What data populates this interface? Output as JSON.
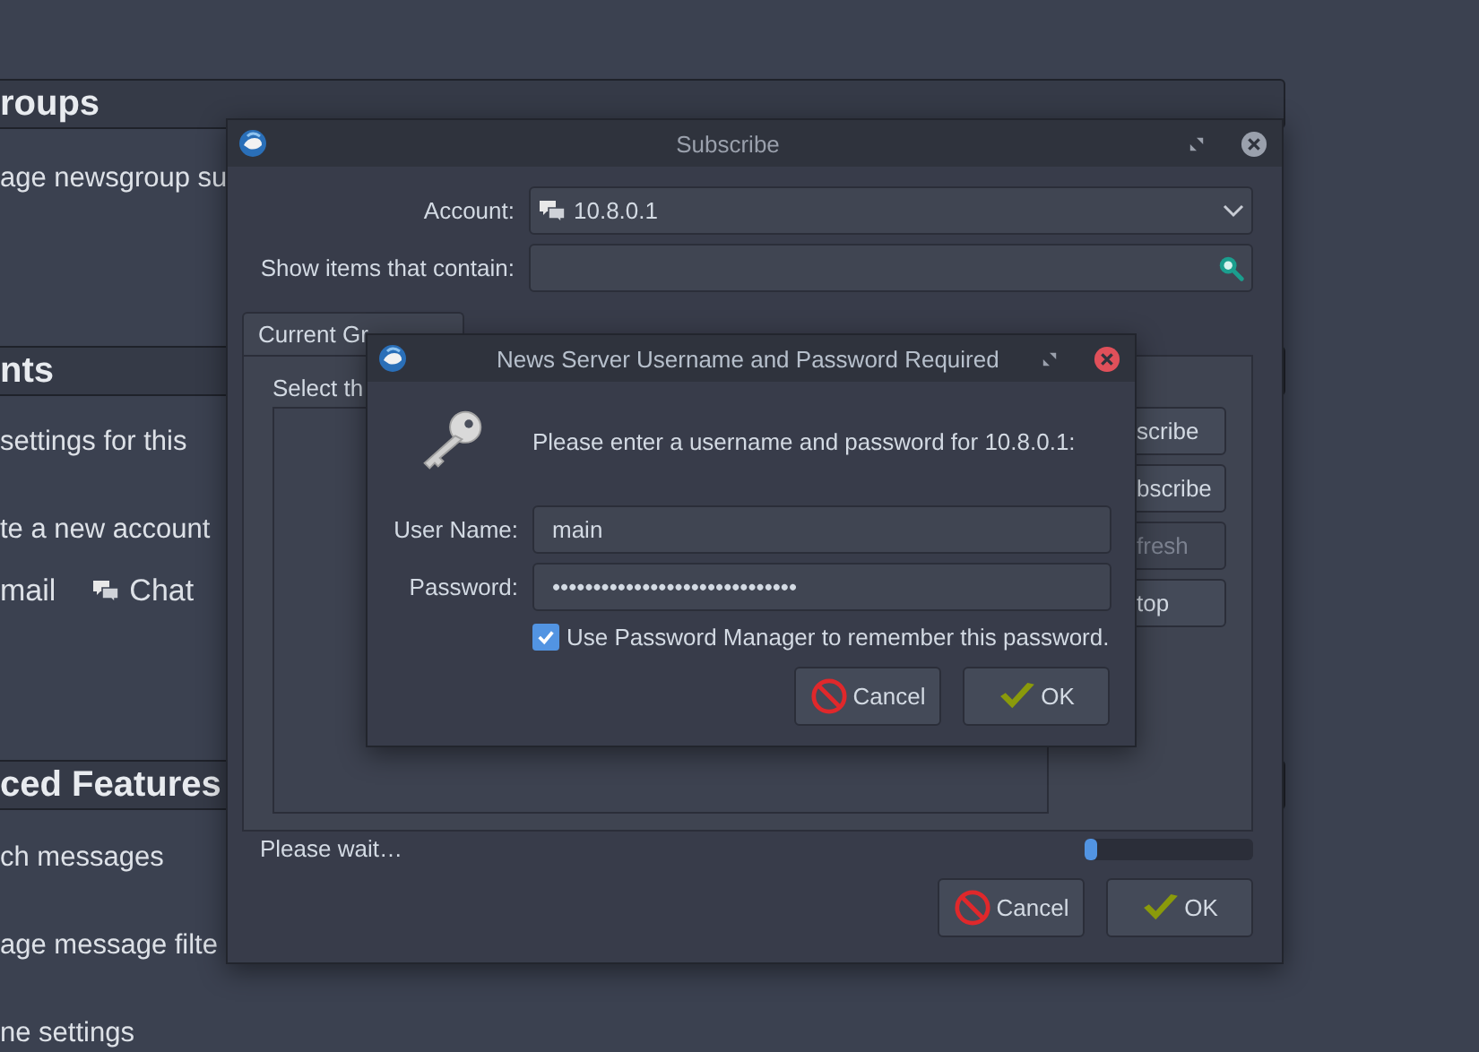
{
  "background_page": {
    "sections": [
      {
        "heading": "roups",
        "items": [
          {
            "kind": "text",
            "text": "age newsgroup su"
          }
        ]
      },
      {
        "heading": "nts",
        "items": [
          {
            "kind": "text",
            "text": "settings for this"
          },
          {
            "kind": "text",
            "text": "te a new account"
          },
          {
            "kind": "links",
            "links": [
              {
                "label": "mail",
                "kind": "plain"
              },
              {
                "label": "Chat",
                "kind": "chat"
              }
            ]
          }
        ]
      },
      {
        "heading": "ced Features",
        "items": [
          {
            "kind": "text",
            "text": "ch messages"
          },
          {
            "kind": "text",
            "text": "age message filte"
          },
          {
            "kind": "text",
            "text": "ne settings"
          }
        ]
      }
    ]
  },
  "subscribe_window": {
    "title": "Subscribe",
    "account": {
      "label": "Account:",
      "value": "10.8.0.1"
    },
    "filter": {
      "label": "Show items that contain:"
    },
    "tabs": [
      {
        "label": "Current Gr",
        "selected": true
      }
    ],
    "panel_text": "Select th",
    "side_buttons": [
      {
        "label": "scribe",
        "disabled": false
      },
      {
        "label": "bscribe",
        "disabled": false
      },
      {
        "label": "fresh",
        "disabled": true
      },
      {
        "label": "top",
        "disabled": false
      }
    ],
    "status": "Please wait…",
    "progress": {
      "level": 0.07
    },
    "buttons": [
      {
        "kind": "cancel",
        "label": "Cancel"
      },
      {
        "kind": "ok",
        "label": "OK"
      }
    ]
  },
  "auth_dialog": {
    "title": "News Server Username and Password Required",
    "message": "Please enter a username and password for 10.8.0.1:",
    "fields": [
      {
        "label": "User Name:",
        "value": "main"
      },
      {
        "label": "Password:",
        "value": "••••••••••••••••••••••••••••••"
      }
    ],
    "remember": {
      "label": "Use Password Manager to remember this password.",
      "checked": true
    },
    "buttons": [
      {
        "kind": "cancel",
        "label": "Cancel"
      },
      {
        "kind": "ok",
        "label": "OK"
      }
    ]
  }
}
